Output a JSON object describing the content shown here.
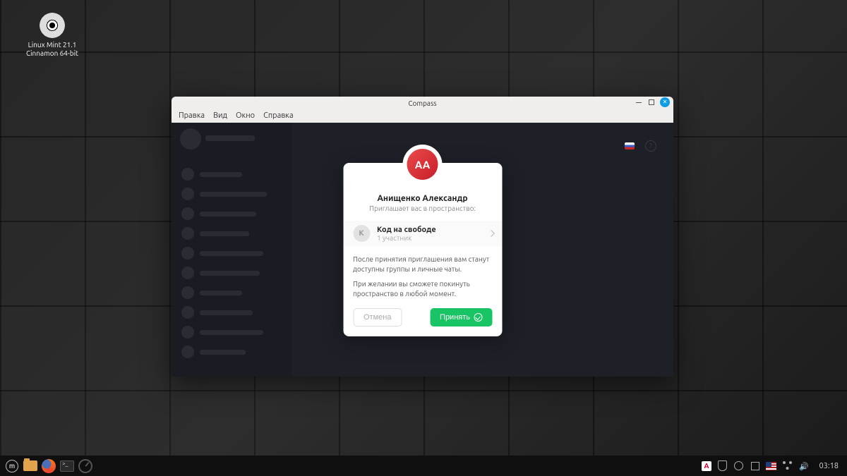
{
  "desktop": {
    "icon_label_1": "Linux Mint 21.1",
    "icon_label_2": "Cinnamon 64-bit"
  },
  "window": {
    "title": "Compass",
    "menus": {
      "edit": "Правка",
      "view": "Вид",
      "window": "Окно",
      "help": "Справка"
    }
  },
  "modal": {
    "avatar_initials": "АА",
    "inviter_name": "Анищенко Александр",
    "inviter_sub": "Приглашает вас в пространство:",
    "space_initial": "К",
    "space_name": "Код на свободе",
    "space_members": "1 участник",
    "desc1": "После принятия приглашения вам станут доступны группы и личные чаты.",
    "desc2": "При желании вы сможете покинуть пространство в любой момент.",
    "cancel": "Отмена",
    "accept": "Принять"
  },
  "taskbar": {
    "time": "03:18"
  }
}
